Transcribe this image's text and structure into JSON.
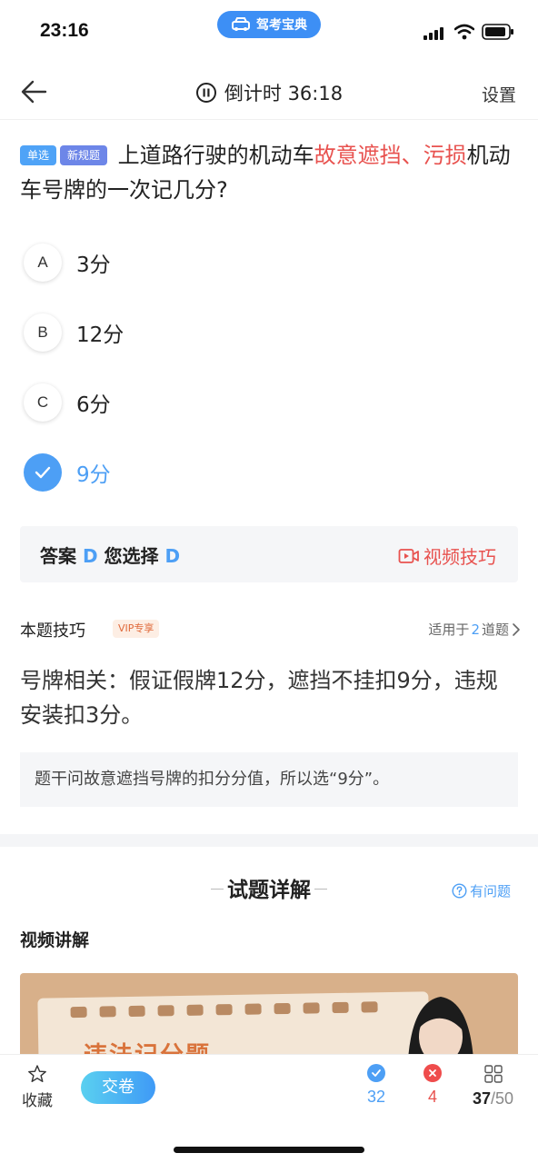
{
  "status": {
    "time": "23:16",
    "app_name": "驾考宝典"
  },
  "header": {
    "timer_label": "倒计时 36:18",
    "settings_label": "设置"
  },
  "question": {
    "tags": [
      "单选",
      "新规题"
    ],
    "text_before": "上道路行驶的机动车",
    "text_highlight": "故意遮挡、污损",
    "text_after": "机动车号牌的一次记几分?"
  },
  "options": [
    {
      "letter": "A",
      "text": "3分"
    },
    {
      "letter": "B",
      "text": "12分"
    },
    {
      "letter": "C",
      "text": "6分"
    },
    {
      "letter": "D",
      "text": "9分",
      "selected": true
    }
  ],
  "answer": {
    "answer_label": "答案",
    "answer_value": "D",
    "chosen_label": "您选择",
    "chosen_value": "D",
    "video_tip": "视频技巧"
  },
  "tips": {
    "title": "本题技巧",
    "vip": "VIP专享",
    "applies_prefix": "适用于",
    "applies_count": "2",
    "applies_suffix": "道题",
    "text": "号牌相关：假证假牌12分，遮挡不挂扣9分，违规安装扣3分。",
    "note": "题干问故意遮挡号牌的扣分分值，所以选“9分”。"
  },
  "detail": {
    "title": "试题详解",
    "ask": "有问题",
    "video_title": "视频讲解",
    "thumb_text": "违法记分题"
  },
  "bottom": {
    "fav_label": "收藏",
    "submit_label": "交卷",
    "correct_count": "32",
    "wrong_count": "4",
    "current": "37",
    "total": "/50"
  },
  "colors": {
    "accent": "#4d9ff5",
    "highlight": "#e8524f"
  }
}
